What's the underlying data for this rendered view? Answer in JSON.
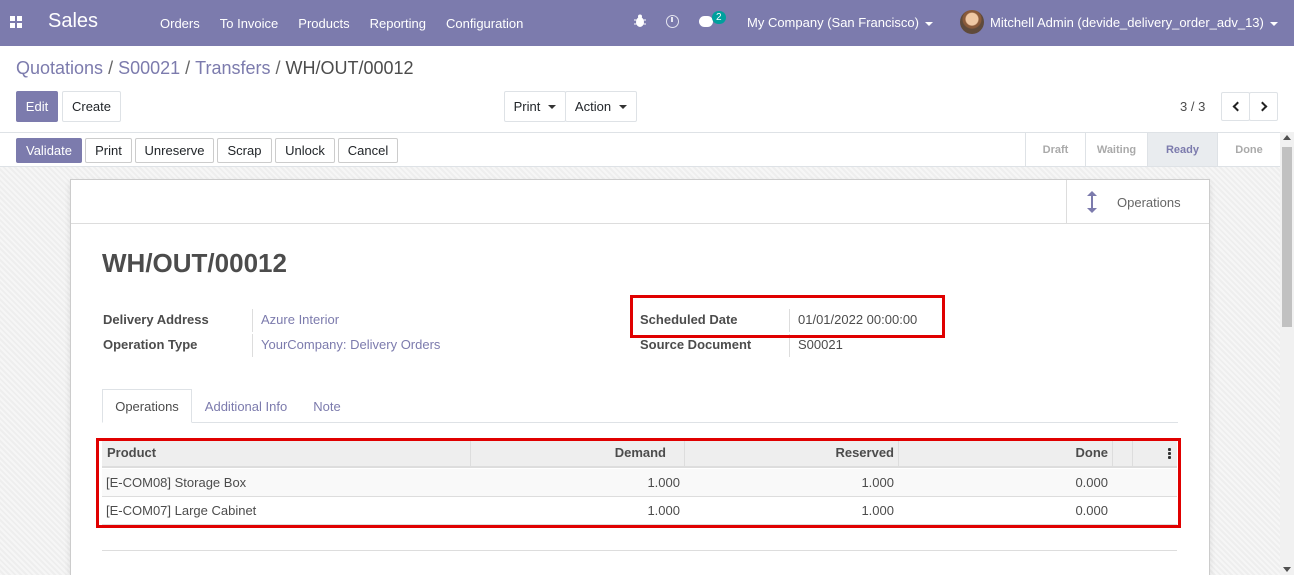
{
  "navbar": {
    "app_name": "Sales",
    "menu": [
      "Orders",
      "To Invoice",
      "Products",
      "Reporting",
      "Configuration"
    ],
    "chat_badge": "2",
    "company": "My Company (San Francisco)",
    "user": "Mitchell Admin (devide_delivery_order_adv_13)"
  },
  "breadcrumb": {
    "items": [
      "Quotations",
      "S00021",
      "Transfers"
    ],
    "current": "WH/OUT/00012"
  },
  "controls": {
    "edit_label": "Edit",
    "create_label": "Create",
    "print_label": "Print",
    "action_label": "Action",
    "pager": "3 / 3"
  },
  "statusbar": {
    "buttons": [
      "Validate",
      "Print",
      "Unreserve",
      "Scrap",
      "Unlock",
      "Cancel"
    ],
    "stages": [
      "Draft",
      "Waiting",
      "Ready",
      "Done"
    ],
    "active_stage": "Ready"
  },
  "sheet": {
    "smart_button_label": "Operations",
    "name": "WH/OUT/00012",
    "fields_left": [
      {
        "label": "Delivery Address",
        "value": "Azure Interior"
      },
      {
        "label": "Operation Type",
        "value": "YourCompany: Delivery Orders"
      }
    ],
    "fields_right": [
      {
        "label": "Scheduled Date",
        "value": "01/01/2022 00:00:00"
      },
      {
        "label": "Source Document",
        "value": "S00021"
      }
    ],
    "tabs": [
      "Operations",
      "Additional Info",
      "Note"
    ],
    "active_tab": "Operations",
    "table": {
      "columns": [
        "Product",
        "Demand",
        "Reserved",
        "Done"
      ],
      "rows": [
        {
          "product": "[E-COM08] Storage Box",
          "demand": "1.000",
          "reserved": "1.000",
          "done": "0.000"
        },
        {
          "product": "[E-COM07] Large Cabinet",
          "demand": "1.000",
          "reserved": "1.000",
          "done": "0.000"
        }
      ]
    }
  },
  "colors": {
    "brand": "#7c7bad",
    "highlight": "#e00000"
  }
}
